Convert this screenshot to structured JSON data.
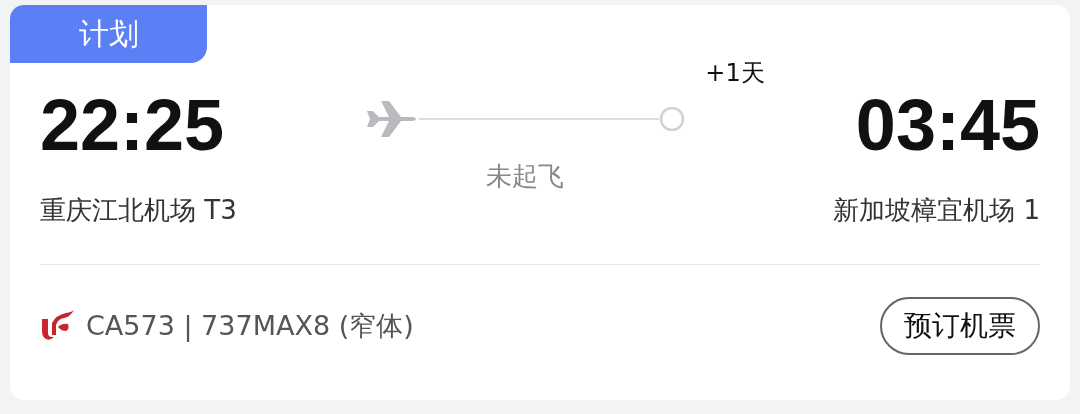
{
  "badge": "计划",
  "departure": {
    "time": "22:25",
    "airport": "重庆江北机场 T3"
  },
  "route": {
    "day_offset": "+1天",
    "status": "未起飞"
  },
  "arrival": {
    "time": "03:45",
    "airport": "新加坡樟宜机场 1"
  },
  "flight": "CA573 | 737MAX8 (窄体)",
  "button": "预订机票"
}
